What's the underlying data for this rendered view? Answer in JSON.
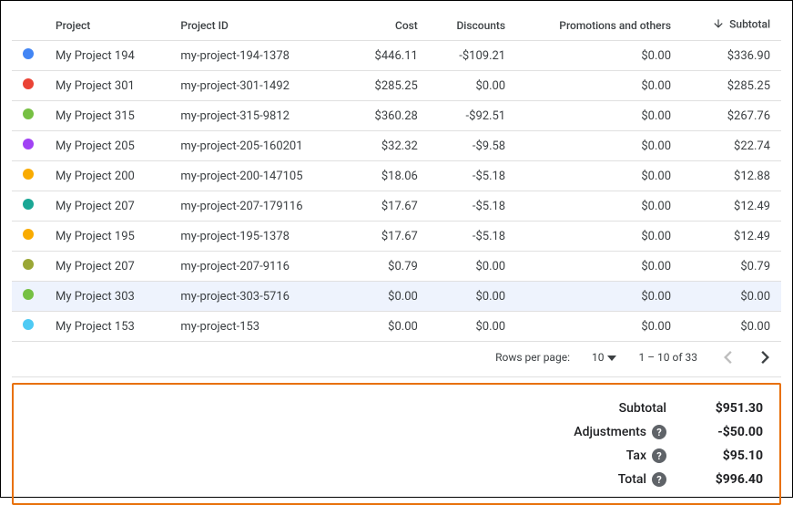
{
  "columns": {
    "project": "Project",
    "project_id": "Project ID",
    "cost": "Cost",
    "discounts": "Discounts",
    "promotions": "Promotions and others",
    "subtotal": "Subtotal"
  },
  "rows": [
    {
      "color": "#4285f4",
      "project": "My Project 194",
      "project_id": "my-project-194-1378",
      "cost": "$446.11",
      "discounts": "-$109.21",
      "promotions": "$0.00",
      "subtotal": "$336.90",
      "highlight": false
    },
    {
      "color": "#ea4335",
      "project": "My Project 301",
      "project_id": "my-project-301-1492",
      "cost": "$285.25",
      "discounts": "$0.00",
      "promotions": "$0.00",
      "subtotal": "$285.25",
      "highlight": false
    },
    {
      "color": "#76c043",
      "project": "My Project 315",
      "project_id": "my-project-315-9812",
      "cost": "$360.28",
      "discounts": "-$92.51",
      "promotions": "$0.00",
      "subtotal": "$267.76",
      "highlight": false
    },
    {
      "color": "#a142f4",
      "project": "My Project 205",
      "project_id": "my-project-205-160201",
      "cost": "$32.32",
      "discounts": "-$9.58",
      "promotions": "$0.00",
      "subtotal": "$22.74",
      "highlight": false
    },
    {
      "color": "#f9ab00",
      "project": "My Project 200",
      "project_id": "my-project-200-147105",
      "cost": "$18.06",
      "discounts": "-$5.18",
      "promotions": "$0.00",
      "subtotal": "$12.88",
      "highlight": false
    },
    {
      "color": "#1aa795",
      "project": "My Project 207",
      "project_id": "my-project-207-179116",
      "cost": "$17.67",
      "discounts": "-$5.18",
      "promotions": "$0.00",
      "subtotal": "$12.49",
      "highlight": false
    },
    {
      "color": "#f9ab00",
      "project": "My Project 195",
      "project_id": "my-project-195-1378",
      "cost": "$17.67",
      "discounts": "-$5.18",
      "promotions": "$0.00",
      "subtotal": "$12.49",
      "highlight": false
    },
    {
      "color": "#9aa736",
      "project": "My Project 207",
      "project_id": "my-project-207-9116",
      "cost": "$0.79",
      "discounts": "$0.00",
      "promotions": "$0.00",
      "subtotal": "$0.79",
      "highlight": false
    },
    {
      "color": "#76c043",
      "project": "My Project 303",
      "project_id": "my-project-303-5716",
      "cost": "$0.00",
      "discounts": "$0.00",
      "promotions": "$0.00",
      "subtotal": "$0.00",
      "highlight": true
    },
    {
      "color": "#4ecaf4",
      "project": "My Project 153",
      "project_id": "my-project-153",
      "cost": "$0.00",
      "discounts": "$0.00",
      "promotions": "$0.00",
      "subtotal": "$0.00",
      "highlight": false
    }
  ],
  "pagination": {
    "rows_per_page_label": "Rows per page:",
    "rows_per_page_value": "10",
    "range": "1 – 10 of 33"
  },
  "totals": {
    "subtotal_label": "Subtotal",
    "subtotal_value": "$951.30",
    "adjustments_label": "Adjustments",
    "adjustments_value": "-$50.00",
    "tax_label": "Tax",
    "tax_value": "$95.10",
    "total_label": "Total",
    "total_value": "$996.40"
  }
}
